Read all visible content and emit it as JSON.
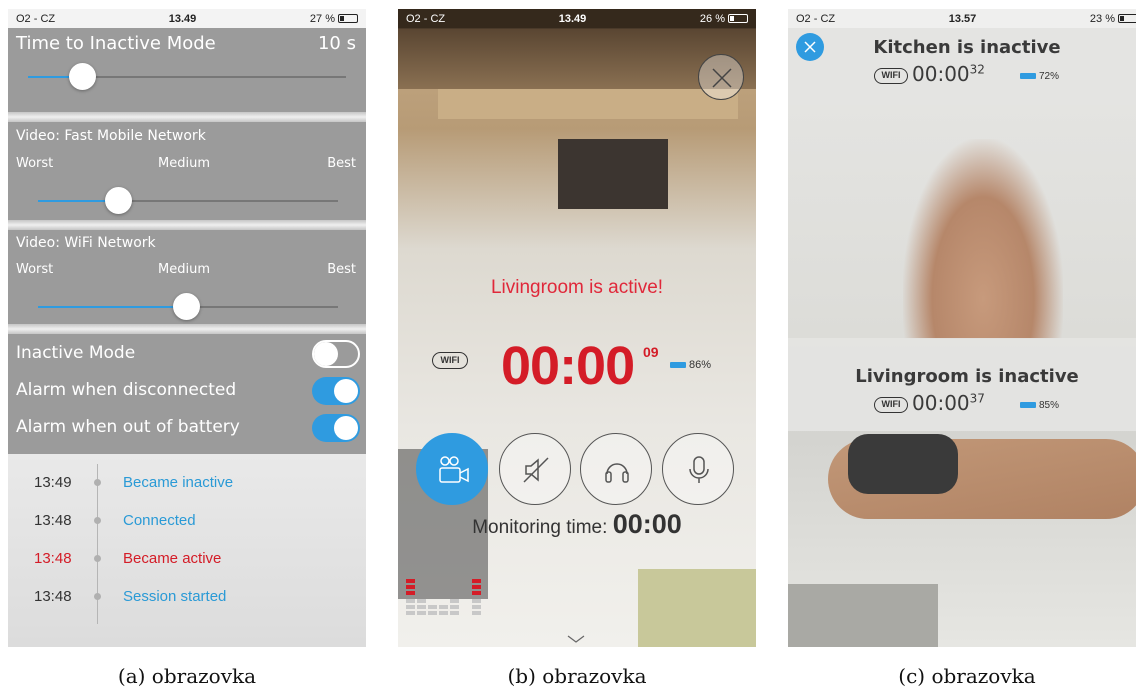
{
  "status_a": {
    "carrier": "O2 - CZ",
    "time": "13.49",
    "battery": "27 %"
  },
  "status_b": {
    "carrier": "O2 - CZ",
    "time": "13.49",
    "battery": "26 %"
  },
  "status_c": {
    "carrier": "O2 - CZ",
    "time": "13.57",
    "battery": "23 %"
  },
  "settings": {
    "inactive_time": {
      "label": "Time to Inactive Mode",
      "value": "10 s",
      "level": 0.2
    },
    "video_mobile": {
      "label": "Video: Fast Mobile Network",
      "worst": "Worst",
      "medium": "Medium",
      "best": "Best",
      "level": 0.27
    },
    "video_wifi": {
      "label": "Video: WiFi Network",
      "worst": "Worst",
      "medium": "Medium",
      "best": "Best",
      "level": 0.5
    },
    "toggles": [
      {
        "label": "Inactive Mode",
        "on": false
      },
      {
        "label": "Alarm when disconnected",
        "on": true
      },
      {
        "label": "Alarm when out of battery",
        "on": true
      }
    ]
  },
  "log": [
    {
      "time": "13:49",
      "event": "Became inactive",
      "highlight": false
    },
    {
      "time": "13:48",
      "event": "Connected",
      "highlight": false
    },
    {
      "time": "13:48",
      "event": "Became active",
      "highlight": true
    },
    {
      "time": "13:48",
      "event": "Session started",
      "highlight": false
    }
  ],
  "camera": {
    "title": "Livingroom is active!",
    "wifi": "WIFI",
    "time": "00:00",
    "seconds": "09",
    "battery": "86%",
    "monitoring_label": "Monitoring time:",
    "monitoring_value": "00:00",
    "controls": [
      "video-camera-icon",
      "speaker-muted-icon",
      "headphones-icon",
      "microphone-icon"
    ]
  },
  "dual": {
    "top": {
      "title": "Kitchen is inactive",
      "wifi": "WIFI",
      "time": "00:00",
      "seconds": "32",
      "battery": "72%"
    },
    "bottom": {
      "title": "Livingroom is inactive",
      "wifi": "WIFI",
      "time": "00:00",
      "seconds": "37",
      "battery": "85%"
    }
  },
  "captions": [
    "(a) obrazovka",
    "(b) obrazovka",
    "(c) obrazovka"
  ],
  "colors": {
    "accent": "#2f9be0",
    "alert": "#d41c27"
  }
}
